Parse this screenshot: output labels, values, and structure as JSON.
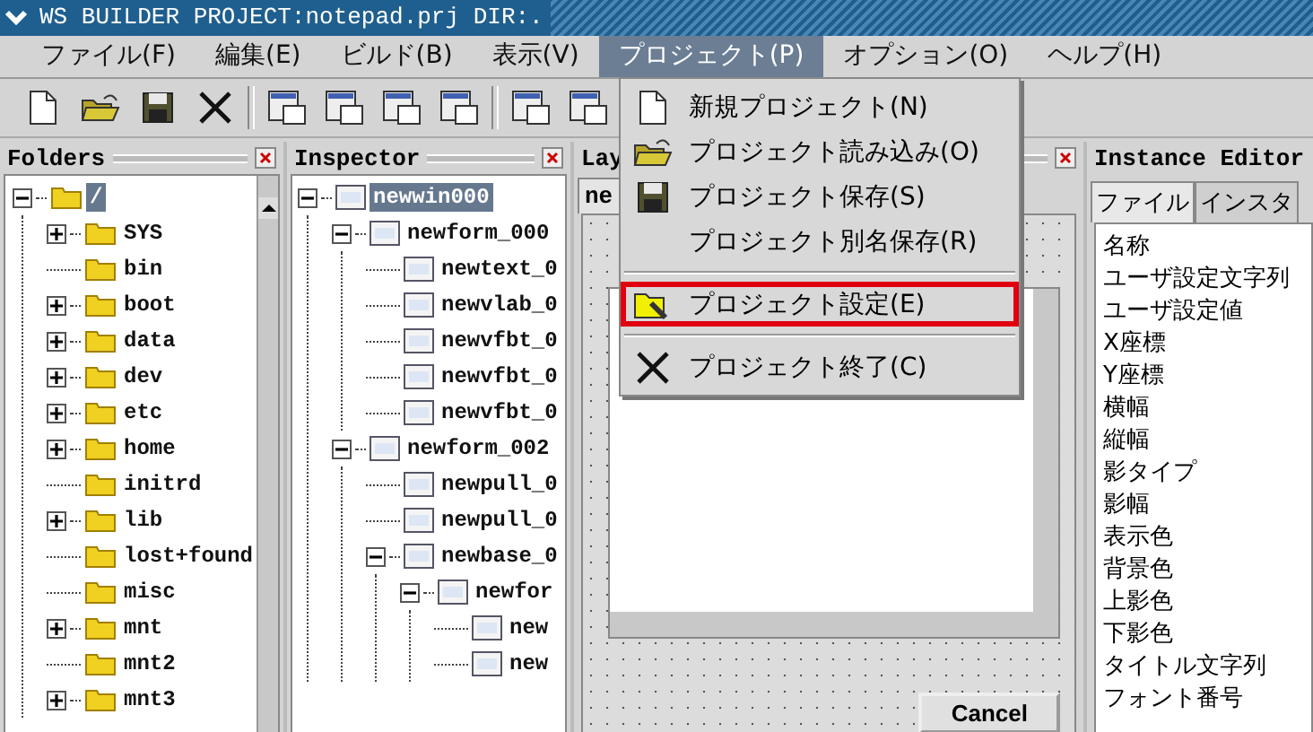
{
  "window": {
    "title": "WS BUILDER PROJECT:notepad.prj DIR:."
  },
  "menubar": [
    {
      "label": "ファイル(F)",
      "selected": false
    },
    {
      "label": "編集(E)",
      "selected": false
    },
    {
      "label": "ビルド(B)",
      "selected": false
    },
    {
      "label": "表示(V)",
      "selected": false
    },
    {
      "label": "プロジェクト(P)",
      "selected": true
    },
    {
      "label": "オプション(O)",
      "selected": false
    },
    {
      "label": "ヘルプ(H)",
      "selected": false
    }
  ],
  "project_menu": [
    {
      "label": "新規プロジェクト(N)",
      "separator_before": false,
      "highlighted": false
    },
    {
      "label": "プロジェクト読み込み(O)",
      "separator_before": false,
      "highlighted": false
    },
    {
      "label": "プロジェクト保存(S)",
      "separator_before": false,
      "highlighted": false
    },
    {
      "label": "プロジェクト別名保存(R)",
      "separator_before": false,
      "highlighted": false
    },
    {
      "label": "プロジェクト設定(E)",
      "separator_before": true,
      "highlighted": true
    },
    {
      "label": "プロジェクト終了(C)",
      "separator_before": true,
      "highlighted": false
    }
  ],
  "folders": {
    "title": "Folders",
    "tree": [
      {
        "label": "/",
        "kind": "branch",
        "expanded": true,
        "selected": true,
        "children": [
          {
            "label": "SYS",
            "kind": "branch",
            "expanded": false,
            "selected": false
          },
          {
            "label": "bin",
            "kind": "leaf",
            "selected": false
          },
          {
            "label": "boot",
            "kind": "branch",
            "expanded": false,
            "selected": false
          },
          {
            "label": "data",
            "kind": "branch",
            "expanded": false,
            "selected": false
          },
          {
            "label": "dev",
            "kind": "branch",
            "expanded": false,
            "selected": false
          },
          {
            "label": "etc",
            "kind": "branch",
            "expanded": false,
            "selected": false
          },
          {
            "label": "home",
            "kind": "branch",
            "expanded": false,
            "selected": false
          },
          {
            "label": "initrd",
            "kind": "leaf",
            "selected": false
          },
          {
            "label": "lib",
            "kind": "branch",
            "expanded": false,
            "selected": false
          },
          {
            "label": "lost+found",
            "kind": "leaf",
            "selected": false
          },
          {
            "label": "misc",
            "kind": "leaf",
            "selected": false
          },
          {
            "label": "mnt",
            "kind": "branch",
            "expanded": false,
            "selected": false
          },
          {
            "label": "mnt2",
            "kind": "leaf",
            "selected": false
          },
          {
            "label": "mnt3",
            "kind": "branch",
            "expanded": false,
            "selected": false
          }
        ]
      }
    ]
  },
  "inspector": {
    "title": "Inspector",
    "tree": [
      {
        "label": "newwin000",
        "kind": "branch",
        "expanded": true,
        "selected": true,
        "children": [
          {
            "label": "newform_000",
            "kind": "branch",
            "expanded": true,
            "selected": false,
            "children": [
              {
                "label": "newtext_0",
                "kind": "leaf",
                "selected": false
              },
              {
                "label": "newvlab_0",
                "kind": "leaf",
                "selected": false
              },
              {
                "label": "newvfbt_0",
                "kind": "leaf",
                "selected": false
              },
              {
                "label": "newvfbt_0",
                "kind": "leaf",
                "selected": false
              },
              {
                "label": "newvfbt_0",
                "kind": "leaf",
                "selected": false
              }
            ]
          },
          {
            "label": "newform_002",
            "kind": "branch",
            "expanded": true,
            "selected": false,
            "children": [
              {
                "label": "newpull_0",
                "kind": "leaf",
                "selected": false
              },
              {
                "label": "newpull_0",
                "kind": "leaf",
                "selected": false
              },
              {
                "label": "newbase_0",
                "kind": "branch",
                "expanded": true,
                "selected": false,
                "children": [
                  {
                    "label": "newfor",
                    "kind": "branch",
                    "expanded": true,
                    "selected": false,
                    "children": [
                      {
                        "label": "new",
                        "kind": "leaf",
                        "selected": false
                      },
                      {
                        "label": "new",
                        "kind": "leaf",
                        "selected": false
                      }
                    ]
                  }
                ]
              }
            ]
          }
        ]
      }
    ]
  },
  "layout": {
    "title": "Lay",
    "tab": "ne",
    "button": "Cancel"
  },
  "instance_editor": {
    "title": "Instance Editor",
    "tabs": [
      {
        "label": "ファイル",
        "selected": true
      },
      {
        "label": "インスタ",
        "selected": false
      }
    ],
    "properties": [
      "名称",
      "ユーザ設定文字列",
      "ユーザ設定値",
      "X座標",
      "Y座標",
      "横幅",
      "縦幅",
      "影タイプ",
      "影幅",
      "表示色",
      "背景色",
      "上影色",
      "下影色",
      "タイトル文字列",
      "フォント番号"
    ]
  }
}
